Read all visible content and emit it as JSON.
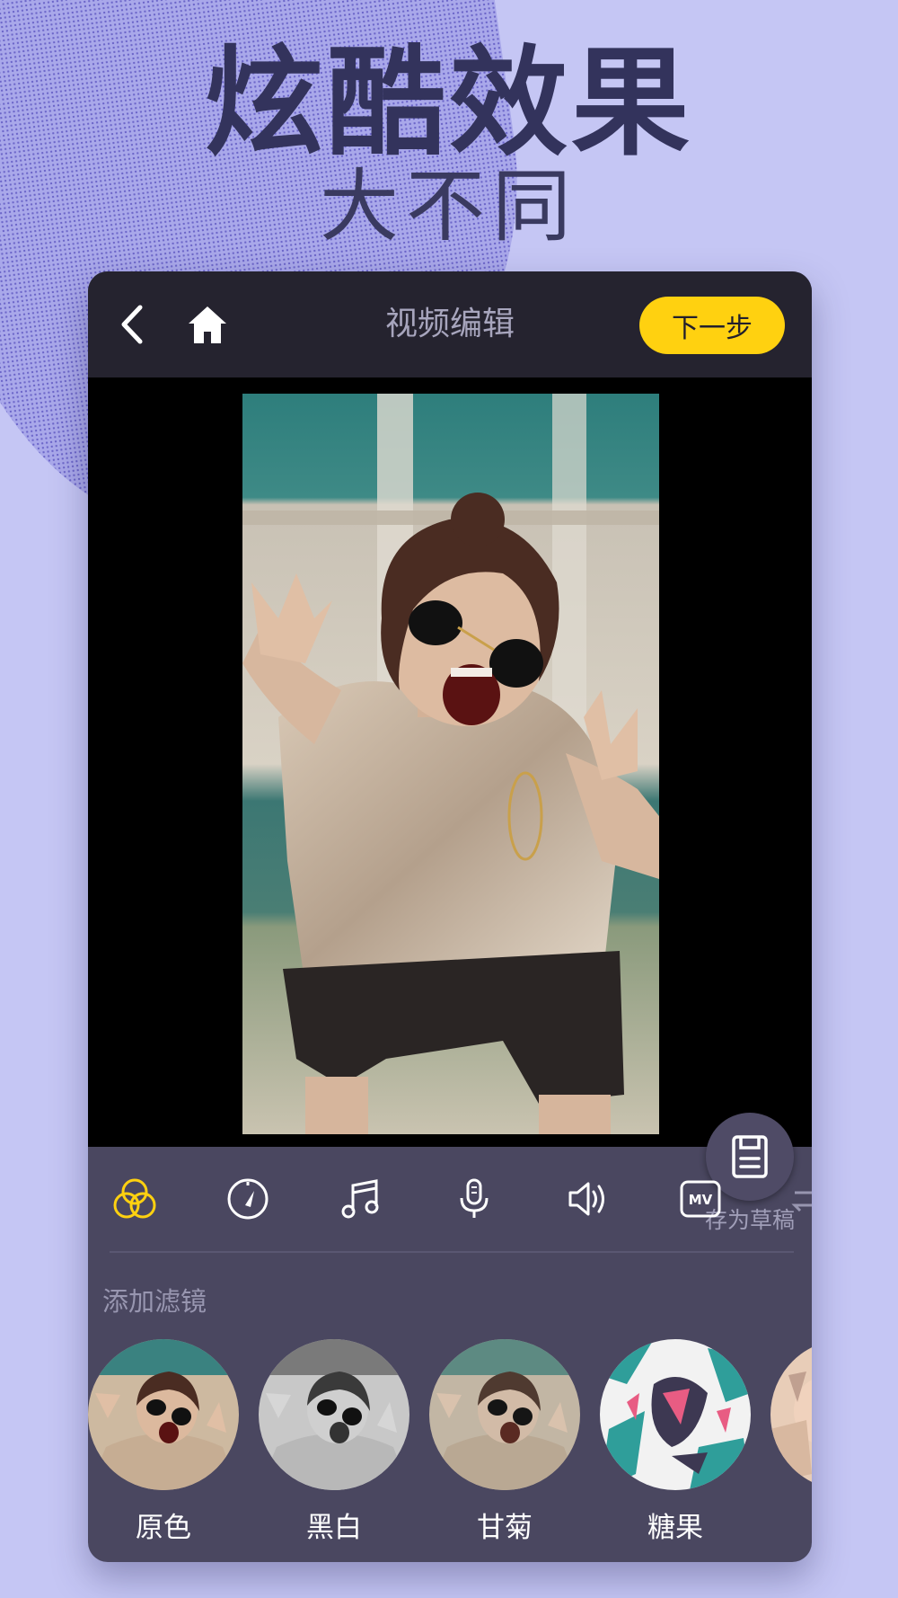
{
  "headline": {
    "main": "炫酷效果",
    "sub": "大不同"
  },
  "topbar": {
    "back_icon": "chevron-left-icon",
    "home_icon": "home-icon",
    "title": "视频编辑",
    "next_label": "下一步"
  },
  "preview": {
    "draft_icon": "document-save-icon",
    "draft_label": "存为草稿"
  },
  "tools": [
    {
      "icon": "filter-circles-icon",
      "active": true
    },
    {
      "icon": "speed-gauge-icon",
      "active": false
    },
    {
      "icon": "music-note-icon",
      "active": false
    },
    {
      "icon": "microphone-icon",
      "active": false
    },
    {
      "icon": "volume-icon",
      "active": false
    },
    {
      "icon": "mv-icon",
      "active": false,
      "text": "MV"
    },
    {
      "icon": "transition-icon",
      "active": false
    }
  ],
  "section": {
    "label": "添加滤镜"
  },
  "filters": [
    {
      "label": "原色"
    },
    {
      "label": "黑白"
    },
    {
      "label": "甘菊"
    },
    {
      "label": "糖果"
    }
  ],
  "colors": {
    "accent": "#ffd110",
    "background": "#c5c6f4",
    "headline": "#33335c",
    "panel": "#4a4760",
    "topbar": "#25232f"
  }
}
